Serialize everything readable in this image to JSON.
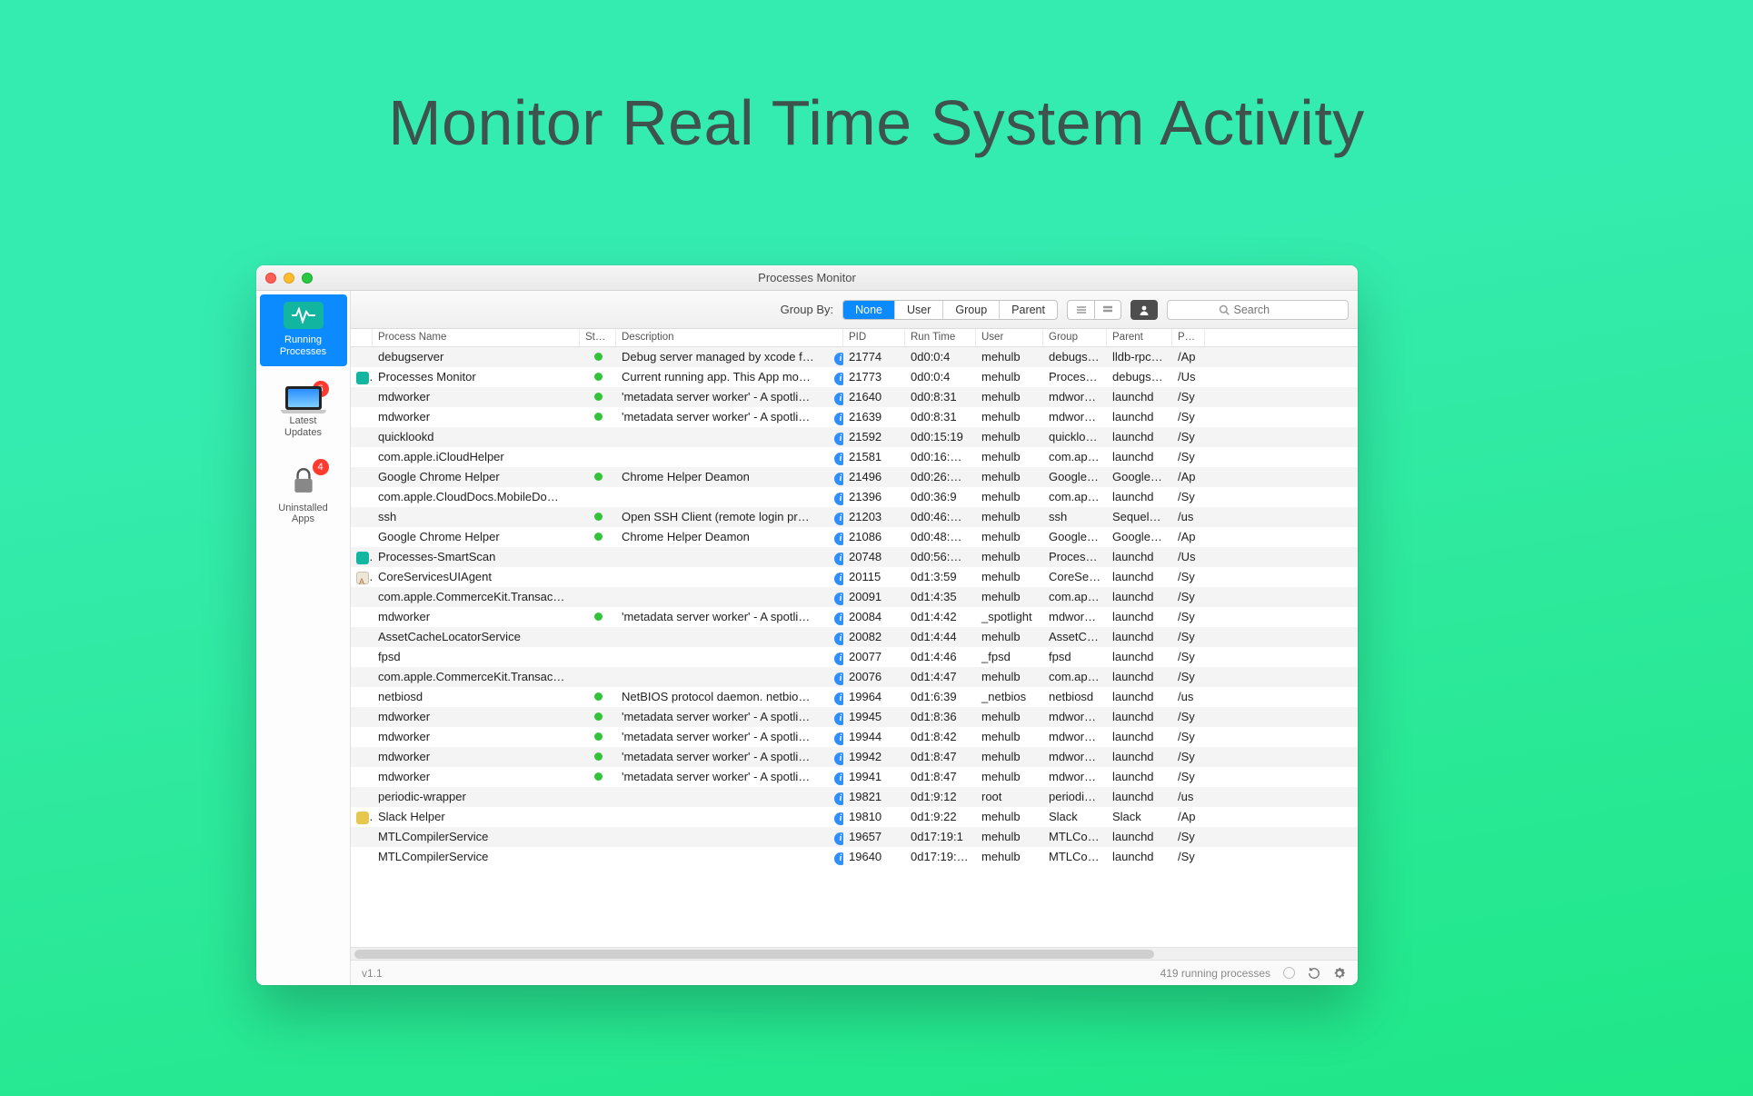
{
  "hero": "Monitor Real Time System Activity",
  "window_title": "Processes Monitor",
  "sidebar": {
    "items": [
      {
        "label": "Running\nProcesses",
        "badge": ""
      },
      {
        "label": "Latest\nUpdates",
        "badge": "6"
      },
      {
        "label": "Uninstalled\nApps",
        "badge": "4"
      }
    ]
  },
  "toolbar": {
    "group_by_label": "Group By:",
    "segments": [
      "None",
      "User",
      "Group",
      "Parent"
    ],
    "search_placeholder": "Search"
  },
  "columns": [
    "Process Name",
    "Status",
    "Description",
    "PID",
    "Run Time",
    "User",
    "Group",
    "Parent",
    "Path"
  ],
  "rows": [
    {
      "icon": "",
      "name": "debugserver",
      "status": true,
      "desc": "Debug server managed by xcode f…",
      "pid": "21774",
      "run": "0d0:0:4",
      "user": "mehulb",
      "group": "debugs…",
      "parent": "lldb-rpc…",
      "path": "/Ap"
    },
    {
      "icon": "teal",
      "name": "Processes Monitor",
      "status": true,
      "desc": "Current running app. This App mo…",
      "pid": "21773",
      "run": "0d0:0:4",
      "user": "mehulb",
      "group": "Process…",
      "parent": "debugs…",
      "path": "/Us"
    },
    {
      "icon": "",
      "name": "mdworker",
      "status": true,
      "desc": "'metadata server worker' - A spotli…",
      "pid": "21640",
      "run": "0d0:8:31",
      "user": "mehulb",
      "group": "mdwork…",
      "parent": "launchd",
      "path": "/Sy"
    },
    {
      "icon": "",
      "name": "mdworker",
      "status": true,
      "desc": "'metadata server worker' - A spotli…",
      "pid": "21639",
      "run": "0d0:8:31",
      "user": "mehulb",
      "group": "mdwork…",
      "parent": "launchd",
      "path": "/Sy"
    },
    {
      "icon": "",
      "name": "quicklookd",
      "status": false,
      "desc": "",
      "pid": "21592",
      "run": "0d0:15:19",
      "user": "mehulb",
      "group": "quicklo…",
      "parent": "launchd",
      "path": "/Sy"
    },
    {
      "icon": "",
      "name": "com.apple.iCloudHelper",
      "status": false,
      "desc": "",
      "pid": "21581",
      "run": "0d0:16:…",
      "user": "mehulb",
      "group": "com.ap…",
      "parent": "launchd",
      "path": "/Sy"
    },
    {
      "icon": "",
      "name": "Google Chrome Helper",
      "status": true,
      "desc": "Chrome Helper Deamon",
      "pid": "21496",
      "run": "0d0:26:…",
      "user": "mehulb",
      "group": "Google…",
      "parent": "Google…",
      "path": "/Ap"
    },
    {
      "icon": "",
      "name": "com.apple.CloudDocs.MobileDo…",
      "status": false,
      "desc": "",
      "pid": "21396",
      "run": "0d0:36:9",
      "user": "mehulb",
      "group": "com.ap…",
      "parent": "launchd",
      "path": "/Sy"
    },
    {
      "icon": "",
      "name": "ssh",
      "status": true,
      "desc": "Open SSH Client (remote login pr…",
      "pid": "21203",
      "run": "0d0:46:…",
      "user": "mehulb",
      "group": "ssh",
      "parent": "Sequel…",
      "path": "/us"
    },
    {
      "icon": "",
      "name": "Google Chrome Helper",
      "status": true,
      "desc": "Chrome Helper Deamon",
      "pid": "21086",
      "run": "0d0:48:…",
      "user": "mehulb",
      "group": "Google…",
      "parent": "Google…",
      "path": "/Ap"
    },
    {
      "icon": "teal",
      "name": "Processes-SmartScan",
      "status": false,
      "desc": "",
      "pid": "20748",
      "run": "0d0:56:…",
      "user": "mehulb",
      "group": "Process…",
      "parent": "launchd",
      "path": "/Us"
    },
    {
      "icon": "doc",
      "name": "CoreServicesUIAgent",
      "status": false,
      "desc": "",
      "pid": "20115",
      "run": "0d1:3:59",
      "user": "mehulb",
      "group": "CoreSer…",
      "parent": "launchd",
      "path": "/Sy"
    },
    {
      "icon": "",
      "name": "com.apple.CommerceKit.Transac…",
      "status": false,
      "desc": "",
      "pid": "20091",
      "run": "0d1:4:35",
      "user": "mehulb",
      "group": "com.ap…",
      "parent": "launchd",
      "path": "/Sy"
    },
    {
      "icon": "",
      "name": "mdworker",
      "status": true,
      "desc": "'metadata server worker' - A spotli…",
      "pid": "20084",
      "run": "0d1:4:42",
      "user": "_spotlight",
      "group": "mdwork…",
      "parent": "launchd",
      "path": "/Sy"
    },
    {
      "icon": "",
      "name": "AssetCacheLocatorService",
      "status": false,
      "desc": "",
      "pid": "20082",
      "run": "0d1:4:44",
      "user": "mehulb",
      "group": "AssetC…",
      "parent": "launchd",
      "path": "/Sy"
    },
    {
      "icon": "",
      "name": "fpsd",
      "status": false,
      "desc": "",
      "pid": "20077",
      "run": "0d1:4:46",
      "user": "_fpsd",
      "group": "fpsd",
      "parent": "launchd",
      "path": "/Sy"
    },
    {
      "icon": "",
      "name": "com.apple.CommerceKit.Transac…",
      "status": false,
      "desc": "",
      "pid": "20076",
      "run": "0d1:4:47",
      "user": "mehulb",
      "group": "com.ap…",
      "parent": "launchd",
      "path": "/Sy"
    },
    {
      "icon": "",
      "name": "netbiosd",
      "status": true,
      "desc": "NetBIOS protocol daemon. netbio…",
      "pid": "19964",
      "run": "0d1:6:39",
      "user": "_netbios",
      "group": "netbiosd",
      "parent": "launchd",
      "path": "/us"
    },
    {
      "icon": "",
      "name": "mdworker",
      "status": true,
      "desc": "'metadata server worker' - A spotli…",
      "pid": "19945",
      "run": "0d1:8:36",
      "user": "mehulb",
      "group": "mdwork…",
      "parent": "launchd",
      "path": "/Sy"
    },
    {
      "icon": "",
      "name": "mdworker",
      "status": true,
      "desc": "'metadata server worker' - A spotli…",
      "pid": "19944",
      "run": "0d1:8:42",
      "user": "mehulb",
      "group": "mdwork…",
      "parent": "launchd",
      "path": "/Sy"
    },
    {
      "icon": "",
      "name": "mdworker",
      "status": true,
      "desc": "'metadata server worker' - A spotli…",
      "pid": "19942",
      "run": "0d1:8:47",
      "user": "mehulb",
      "group": "mdwork…",
      "parent": "launchd",
      "path": "/Sy"
    },
    {
      "icon": "",
      "name": "mdworker",
      "status": true,
      "desc": "'metadata server worker' - A spotli…",
      "pid": "19941",
      "run": "0d1:8:47",
      "user": "mehulb",
      "group": "mdwork…",
      "parent": "launchd",
      "path": "/Sy"
    },
    {
      "icon": "",
      "name": "periodic-wrapper",
      "status": false,
      "desc": "",
      "pid": "19821",
      "run": "0d1:9:12",
      "user": "root",
      "group": "periodic…",
      "parent": "launchd",
      "path": "/us"
    },
    {
      "icon": "slack",
      "name": "Slack Helper",
      "status": false,
      "desc": "",
      "pid": "19810",
      "run": "0d1:9:22",
      "user": "mehulb",
      "group": "Slack",
      "parent": "Slack",
      "path": "/Ap"
    },
    {
      "icon": "",
      "name": "MTLCompilerService",
      "status": false,
      "desc": "",
      "pid": "19657",
      "run": "0d17:19:1",
      "user": "mehulb",
      "group": "MTLCo…",
      "parent": "launchd",
      "path": "/Sy"
    },
    {
      "icon": "",
      "name": "MTLCompilerService",
      "status": false,
      "desc": "",
      "pid": "19640",
      "run": "0d17:19:…",
      "user": "mehulb",
      "group": "MTLCo…",
      "parent": "launchd",
      "path": "/Sy"
    }
  ],
  "statusbar": {
    "version": "v1.1",
    "process_count": "419 running processes"
  }
}
